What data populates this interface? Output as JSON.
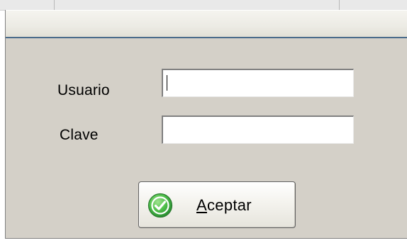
{
  "login": {
    "user_label": "Usuario",
    "password_label": "Clave",
    "user_value": "",
    "password_value": "",
    "accept_button": {
      "mnemonic": "A",
      "rest": "ceptar"
    }
  },
  "icons": {
    "accept": "green-check-circle-icon"
  },
  "colors": {
    "dialog_bg": "#d4d0c8",
    "titlebar_border": "#4a6b8a",
    "check_green": "#3aa84a"
  }
}
